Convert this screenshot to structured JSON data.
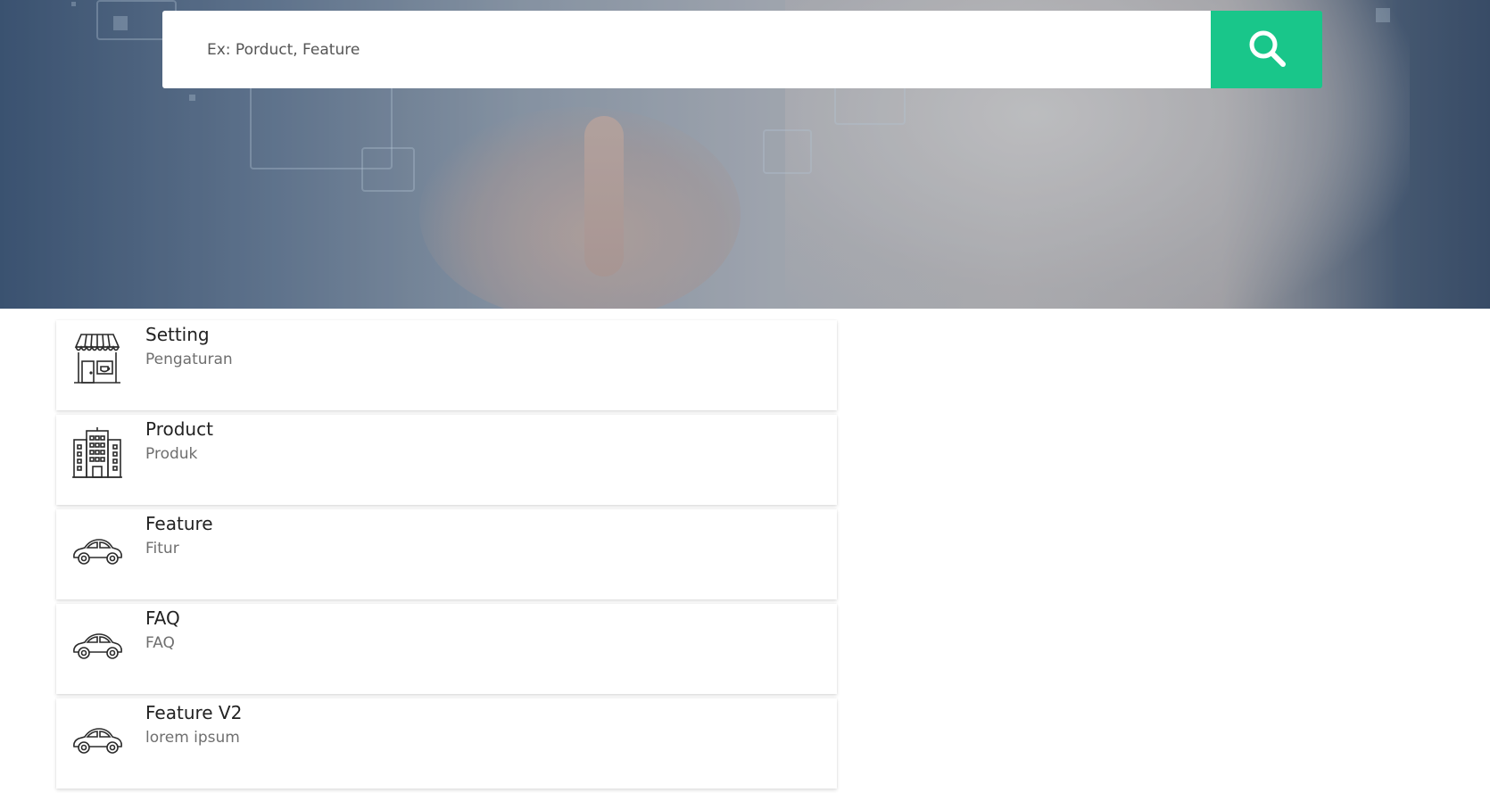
{
  "search": {
    "placeholder": "Ex: Porduct, Feature",
    "button_icon": "search-icon"
  },
  "colors": {
    "accent": "#19c68a",
    "title": "#222222",
    "subtitle": "#6f6f6f"
  },
  "items": [
    {
      "title": "Setting",
      "subtitle": "Pengaturan",
      "icon": "store-icon"
    },
    {
      "title": "Product",
      "subtitle": "Produk",
      "icon": "building-icon"
    },
    {
      "title": "Feature",
      "subtitle": "Fitur",
      "icon": "car-icon"
    },
    {
      "title": "FAQ",
      "subtitle": "FAQ",
      "icon": "car-icon"
    },
    {
      "title": "Feature V2",
      "subtitle": "lorem ipsum",
      "icon": "car-icon"
    }
  ]
}
